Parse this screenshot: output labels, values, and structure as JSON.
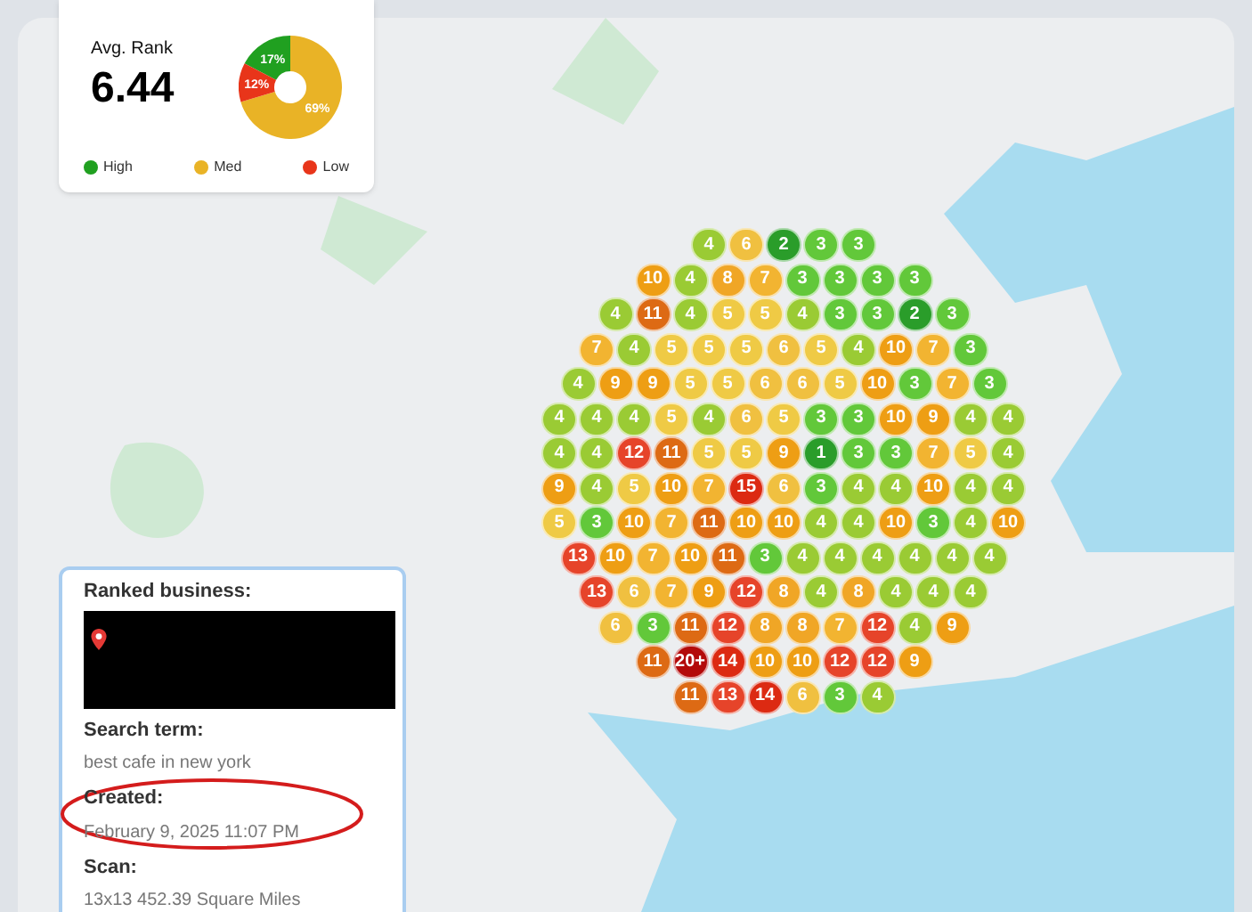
{
  "summary": {
    "label": "Avg. Rank",
    "value": "6.44",
    "chart_data": {
      "type": "donut",
      "categories": [
        "High",
        "Med",
        "Low"
      ],
      "values": [
        17,
        69,
        12
      ],
      "value_labels": [
        "17%",
        "69%",
        "12%"
      ]
    },
    "colors": [
      {
        "color": "#20a020"
      },
      {
        "color": "#e9b326"
      },
      {
        "color": "#e8351a"
      }
    ]
  },
  "pin_rows": [
    [
      "4",
      "6",
      "2",
      "3",
      "3"
    ],
    [
      "10",
      "4",
      "8",
      "7",
      "3",
      "3",
      "3",
      "3"
    ],
    [
      "4",
      "11",
      "4",
      "5",
      "5",
      "4",
      "3",
      "3",
      "2",
      "3"
    ],
    [
      "7",
      "4",
      "5",
      "5",
      "5",
      "6",
      "5",
      "4",
      "10",
      "7",
      "3"
    ],
    [
      "4",
      "9",
      "9",
      "5",
      "5",
      "6",
      "6",
      "5",
      "10",
      "3",
      "7",
      "3"
    ],
    [
      "4",
      "4",
      "4",
      "5",
      "4",
      "6",
      "5",
      "3",
      "3",
      "10",
      "9",
      "4",
      "4"
    ],
    [
      "4",
      "4",
      "12",
      "11",
      "5",
      "5",
      "9",
      "1",
      "3",
      "3",
      "7",
      "5",
      "4"
    ],
    [
      "9",
      "4",
      "5",
      "10",
      "7",
      "15",
      "6",
      "3",
      "4",
      "4",
      "10",
      "4",
      "4"
    ],
    [
      "5",
      "3",
      "10",
      "7",
      "11",
      "10",
      "10",
      "4",
      "4",
      "10",
      "3",
      "4",
      "10"
    ],
    [
      "13",
      "10",
      "7",
      "10",
      "11",
      "3",
      "4",
      "4",
      "4",
      "4",
      "4",
      "4"
    ],
    [
      "13",
      "6",
      "7",
      "9",
      "12",
      "8",
      "4",
      "8",
      "4",
      "4",
      "4"
    ],
    [
      "6",
      "3",
      "11",
      "12",
      "8",
      "8",
      "7",
      "12",
      "4",
      "9"
    ],
    [
      "11",
      "20+",
      "14",
      "10",
      "10",
      "12",
      "12",
      "9"
    ],
    [
      "11",
      "13",
      "14",
      "6",
      "3",
      "4"
    ]
  ],
  "details": {
    "title": "Ranked business:",
    "fields": [
      {
        "label": "Search term:",
        "value": "best cafe in new york",
        "circled": false
      },
      {
        "label": "Created:",
        "value": "February 9, 2025 11:07 PM",
        "circled": true
      },
      {
        "label": "Scan:",
        "value": "13x13 452.39 Square Miles",
        "circled": false
      }
    ]
  }
}
